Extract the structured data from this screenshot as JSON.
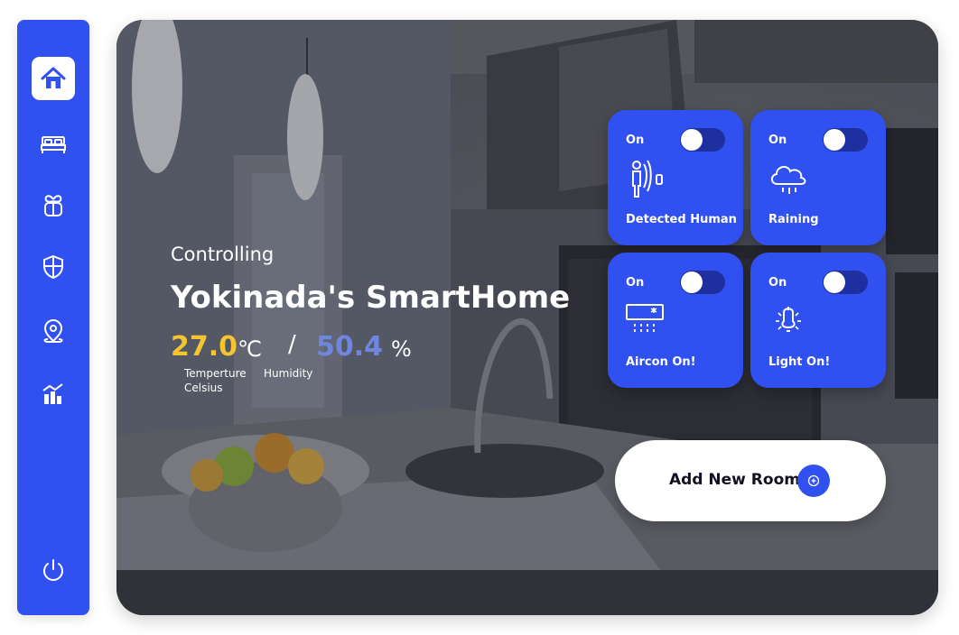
{
  "sidebar": {
    "items": [
      {
        "icon": "home-icon",
        "active": true
      },
      {
        "icon": "bed-icon",
        "active": false
      },
      {
        "icon": "gift-icon",
        "active": false
      },
      {
        "icon": "shield-icon",
        "active": false
      },
      {
        "icon": "location-pin-icon",
        "active": false
      },
      {
        "icon": "stats-icon",
        "active": false
      }
    ],
    "power_icon": "power-icon",
    "color": "#3050f0"
  },
  "hero": {
    "subtitle": "Controlling",
    "title": "Yokinada's SmartHome",
    "temperature": {
      "value": "27.0",
      "unit": "℃",
      "label_line1": "Temperture",
      "label_line2": "Celsius",
      "color": "#f4c431"
    },
    "separator": "/",
    "humidity": {
      "value": "50.4",
      "unit": "%",
      "label": "Humidity",
      "color": "#6e86de"
    }
  },
  "devices": [
    {
      "status": "On",
      "name": "Detected Human",
      "icon": "human-detection-icon",
      "toggle_on": false
    },
    {
      "status": "On",
      "name": "Raining",
      "icon": "rain-cloud-icon",
      "toggle_on": false
    },
    {
      "status": "On",
      "name": "Aircon On!",
      "icon": "aircon-icon",
      "toggle_on": false
    },
    {
      "status": "On",
      "name": "Light On!",
      "icon": "light-bulb-icon",
      "toggle_on": false
    }
  ],
  "add_room": {
    "label": "Add New Room",
    "icon": "plus-circle-icon"
  }
}
